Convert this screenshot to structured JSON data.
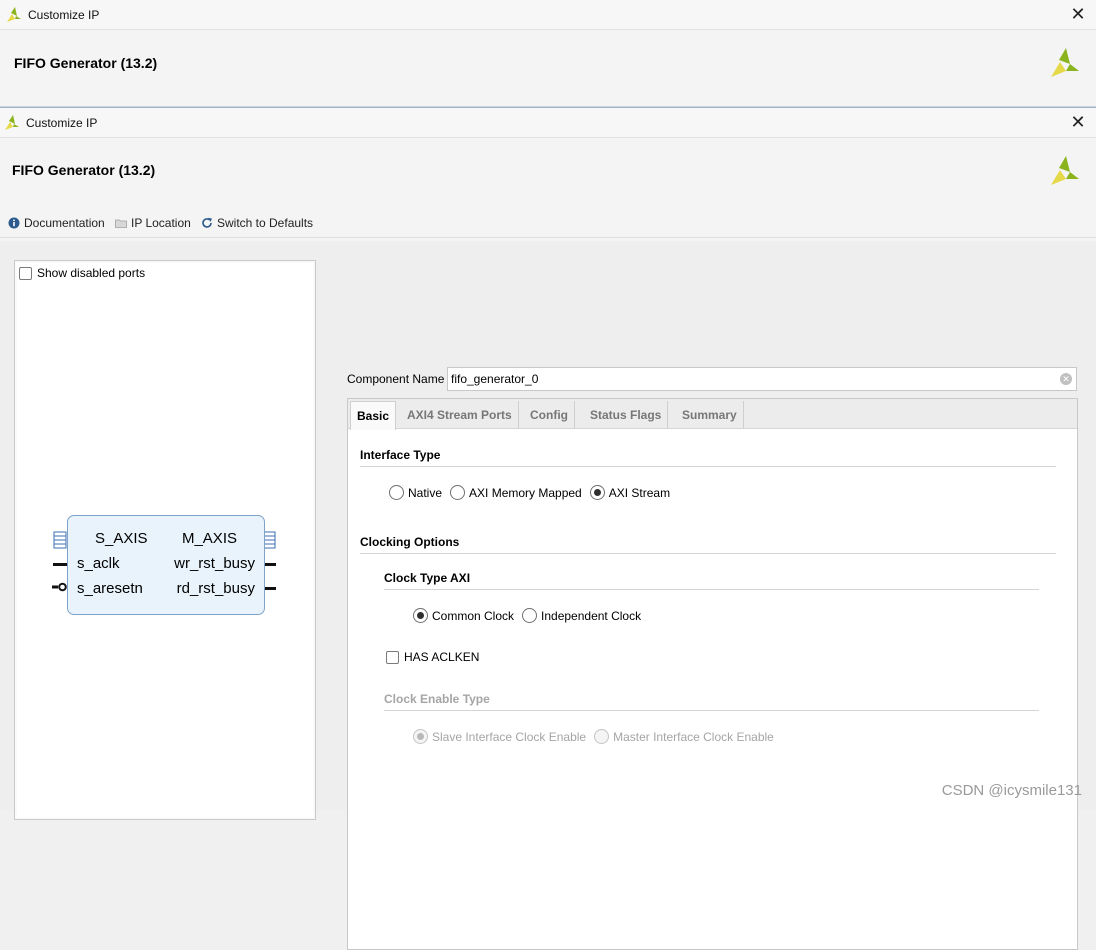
{
  "window1": {
    "title": "Customize IP",
    "close": "✕",
    "product": "FIFO Generator (13.2)"
  },
  "window2": {
    "title": "Customize IP",
    "close": "✕",
    "product": "FIFO Generator (13.2)"
  },
  "toolbar": {
    "documentation": "Documentation",
    "ip_location": "IP Location",
    "switch_defaults": "Switch to Defaults"
  },
  "left_panel": {
    "show_disabled_ports": "Show disabled ports",
    "block": {
      "left_ports": [
        "S_AXIS",
        "s_aclk",
        "s_aresetn"
      ],
      "right_ports": [
        "M_AXIS",
        "wr_rst_busy",
        "rd_rst_busy"
      ]
    }
  },
  "component": {
    "label": "Component Name",
    "value": "fifo_generator_0"
  },
  "tabs": [
    "Basic",
    "AXI4 Stream Ports",
    "Config",
    "Status Flags",
    "Summary"
  ],
  "basic": {
    "interface_type": {
      "heading": "Interface Type",
      "options": [
        "Native",
        "AXI Memory Mapped",
        "AXI Stream"
      ],
      "selected": "AXI Stream"
    },
    "clocking_options": "Clocking Options",
    "clock_type": {
      "heading": "Clock Type AXI",
      "options": [
        "Common Clock",
        "Independent Clock"
      ],
      "selected": "Common Clock"
    },
    "has_aclken": "HAS ACLKEN",
    "clock_enable_type": {
      "heading": "Clock Enable Type",
      "options": [
        "Slave Interface Clock Enable",
        "Master Interface Clock Enable"
      ],
      "selected": "Slave Interface Clock Enable"
    }
  },
  "watermark": "CSDN @icysmile131",
  "colors": {
    "logo_green": "#8bb31d",
    "logo_yellow": "#e5d94a",
    "block_fill": "#e8f3fb",
    "block_border": "#7fa3c8",
    "port_blue": "#3a6fb5"
  }
}
